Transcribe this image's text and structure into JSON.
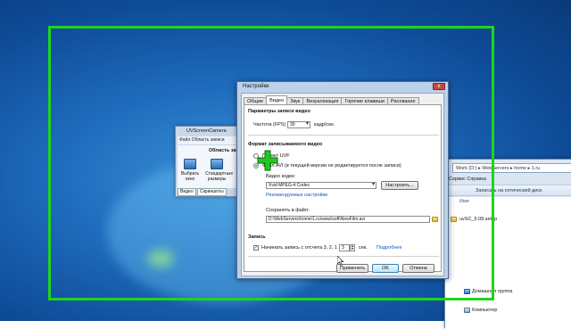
{
  "settings_dialog": {
    "title": "Настройки",
    "close_label": "x",
    "tabs": [
      "Общие",
      "Видео",
      "Звук",
      "Визуализация",
      "Горячие клавиши",
      "Рисование"
    ],
    "active_tab_index": 1,
    "section_recording_params": "Параметры записи видео",
    "fps_label": "Частота (FPS)",
    "fps_value": "30",
    "fps_unit": "кадр/сек.",
    "section_format": "Формат записываемого видео",
    "radio_uvf_label": "Проект UVF",
    "radio_avi_label": "Файл AVI (в текущей версии не редактируется после записи)",
    "codec_label": "Видео кодек:",
    "codec_value": "Xvid MPEG-4 Codec",
    "configure_button": "Настроить...",
    "recommended_link": "Рекомендуемые настройки",
    "save_label": "Сохранять в файл:",
    "save_path": "D:\\WebServers\\home\\1.ru\\www\\soft\\NewFilm.avi",
    "section_record": "Запись",
    "countdown_checked": true,
    "countdown_label": "Начинать запись с отсчета 3, 2, 1",
    "countdown_value": "3",
    "countdown_unit": "сек.",
    "more_link": "Подробнее",
    "apply_button": "Применить",
    "ok_button": "OK",
    "cancel_button": "Отмена",
    "selected_format": "avi"
  },
  "uvscreencamera_window": {
    "title": "UVScreenCamera",
    "menu": "Файл   Область записи",
    "area_label": "Область запи",
    "buttons": [
      "Выбрать окно",
      "Стандартные размеры"
    ],
    "tabs": [
      "Видео",
      "Скриншоты"
    ]
  },
  "explorer_window": {
    "address": "Work (D:) ▸ WebServers ▸ home ▸ 1.ru",
    "menu": "Сервис   Справка",
    "toolbar": "Записать на оптический диск",
    "column_header": "Имя",
    "file_name": "uvSC_5.09.setup",
    "nav_items": [
      "Домашняя группа",
      "Компьютер"
    ]
  },
  "colors": {
    "capture_frame": "#1fd41f",
    "desktop": "#1f6cbd",
    "link": "#1656c9"
  }
}
